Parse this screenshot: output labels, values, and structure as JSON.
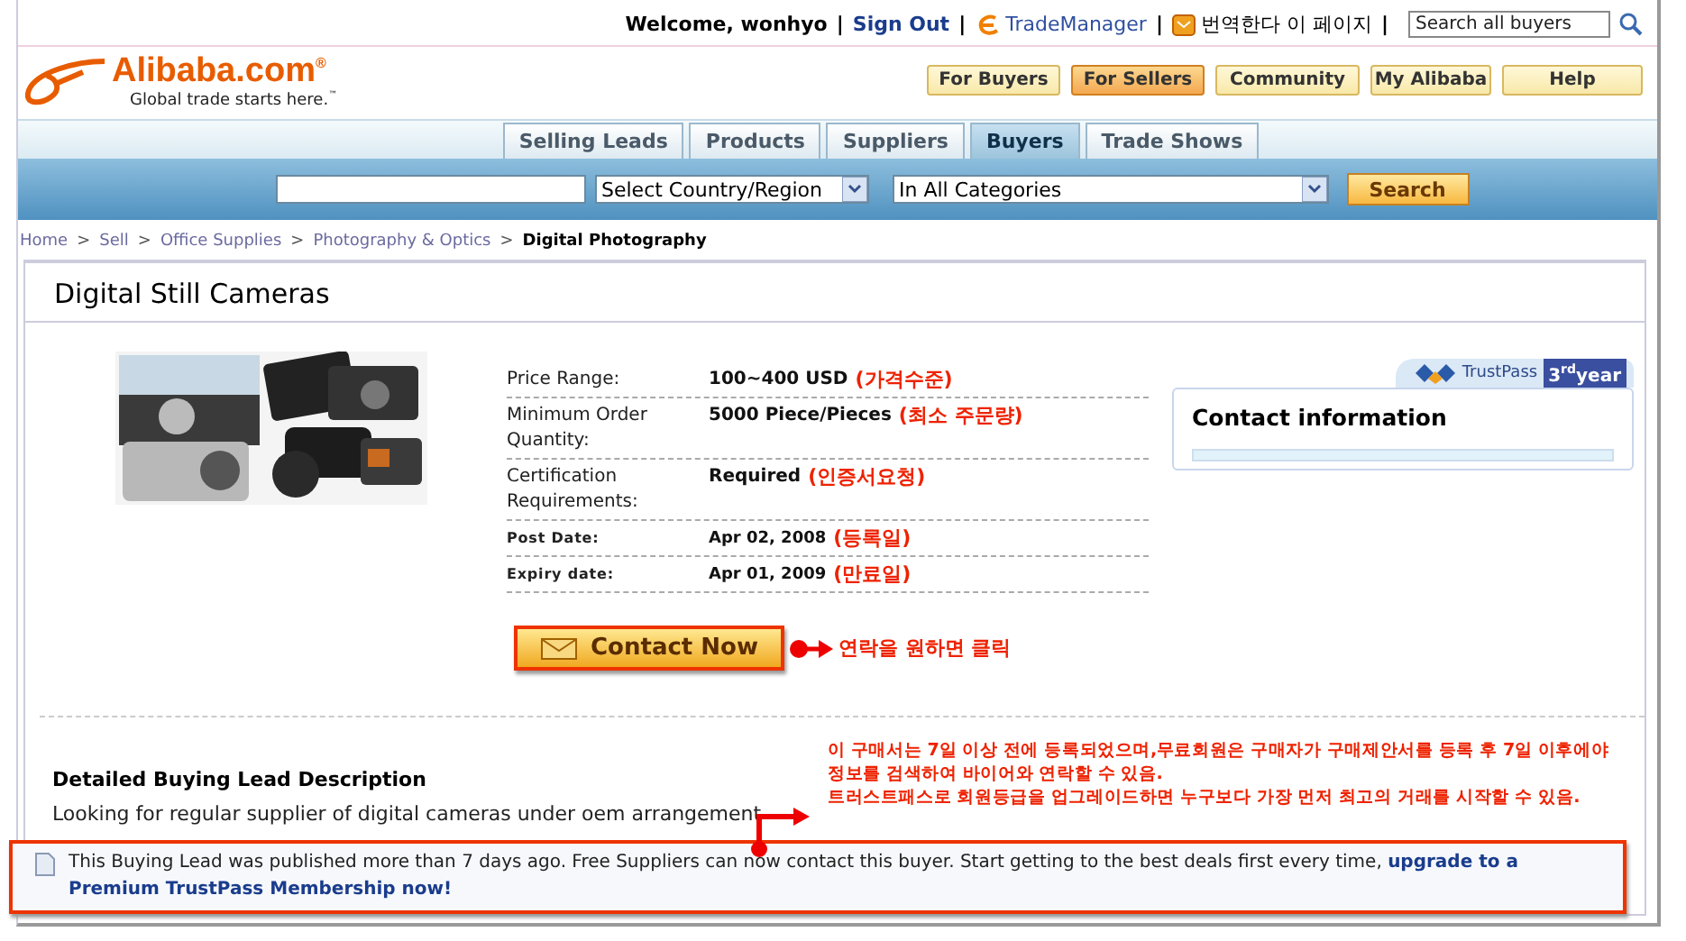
{
  "top_bar": {
    "items": [
      {
        "kind": "bold",
        "text": "Welcome, wonhyo"
      },
      {
        "kind": "sep",
        "text": "|"
      },
      {
        "kind": "link",
        "text": "Sign Out"
      },
      {
        "kind": "sep",
        "text": "|"
      },
      {
        "kind": "trademanager",
        "text": "TradeManager"
      },
      {
        "kind": "sep",
        "text": "|"
      },
      {
        "kind": "translate",
        "text": "번역한다 이 페이지"
      },
      {
        "kind": "sep",
        "text": "|"
      }
    ],
    "search": {
      "placeholder": "Search all buyers"
    }
  },
  "logo": {
    "name": "Alibaba.com$^{®}$",
    "tagline": "Global trade starts here.$^{™}$"
  },
  "nav_buttons": [
    {
      "label": "For Buyers",
      "selected": false
    },
    {
      "label": "For Sellers",
      "selected": true
    },
    {
      "label": "Community",
      "selected": false
    },
    {
      "label": "My Alibaba",
      "selected": false
    },
    {
      "label": "Help",
      "selected": false
    }
  ],
  "tabs": [
    {
      "label": "Selling Leads",
      "selected": false
    },
    {
      "label": "Products",
      "selected": false
    },
    {
      "label": "Suppliers",
      "selected": false
    },
    {
      "label": "Buyers",
      "selected": true
    },
    {
      "label": "Trade Shows",
      "selected": false
    }
  ],
  "search_bar": {
    "country": "Select Country/Region",
    "category": "In All Categories",
    "button": "Search"
  },
  "breadcrumb": [
    {
      "kind": "link",
      "text": "Home"
    },
    {
      "kind": "sep",
      "text": ">"
    },
    {
      "kind": "link",
      "text": "Sell"
    },
    {
      "kind": "sep",
      "text": ">"
    },
    {
      "kind": "link",
      "text": "Office Supplies"
    },
    {
      "kind": "sep",
      "text": ">"
    },
    {
      "kind": "link",
      "text": "Photography & Optics"
    },
    {
      "kind": "sep",
      "text": ">"
    },
    {
      "kind": "current",
      "text": "Digital Photography"
    }
  ],
  "listing": {
    "title": "Digital Still Cameras",
    "details": [
      {
        "kind": "large",
        "label": "Price Range:",
        "value": "100~400 USD",
        "note": "(가격수준)"
      },
      {
        "kind": "large",
        "label": "Minimum Order Quantity:",
        "value": "5000 Piece/Pieces",
        "note": "(최소 주문량)"
      },
      {
        "kind": "large",
        "label": "Certification Requirements:",
        "value": "Required",
        "note": "(인증서요청)"
      },
      {
        "kind": "small",
        "label": "Post Date:",
        "value": "Apr 02, 2008",
        "note": "(등록일)"
      },
      {
        "kind": "small",
        "label": "Expiry date:",
        "value": "Apr 01, 2009",
        "note": "(만료일)"
      }
    ],
    "contact_button": "Contact Now",
    "contact_note": "연락을 원하면 클릭",
    "trustpass": {
      "label": "TrustPass",
      "years": "3$^{rd}$year",
      "heading": "Contact information"
    },
    "description": {
      "heading": "Detailed Buying Lead Description",
      "text": "Looking for regular supplier of digital cameras under oem arrangement"
    },
    "annotation": [
      "이 구매서는 7일 이상 전에 등록되었으며,무료회원은 구매자가 구매제안서를 등록 후 7일 이후에야",
      "정보를 검색하여 바이어와 연락할 수 있음.",
      "트러스트패스로 회원등급을 업그레이드하면 누구보다 가장 먼저 최고의 거래를 시작할 수 있음."
    ],
    "notice": {
      "text": "This Buying Lead was published more than 7 days ago. Free Suppliers can now contact this buyer. Start getting to the best deals first every time,",
      "link": [
        "upgrade to a",
        "Premium TrustPass Membership now!"
      ]
    }
  }
}
